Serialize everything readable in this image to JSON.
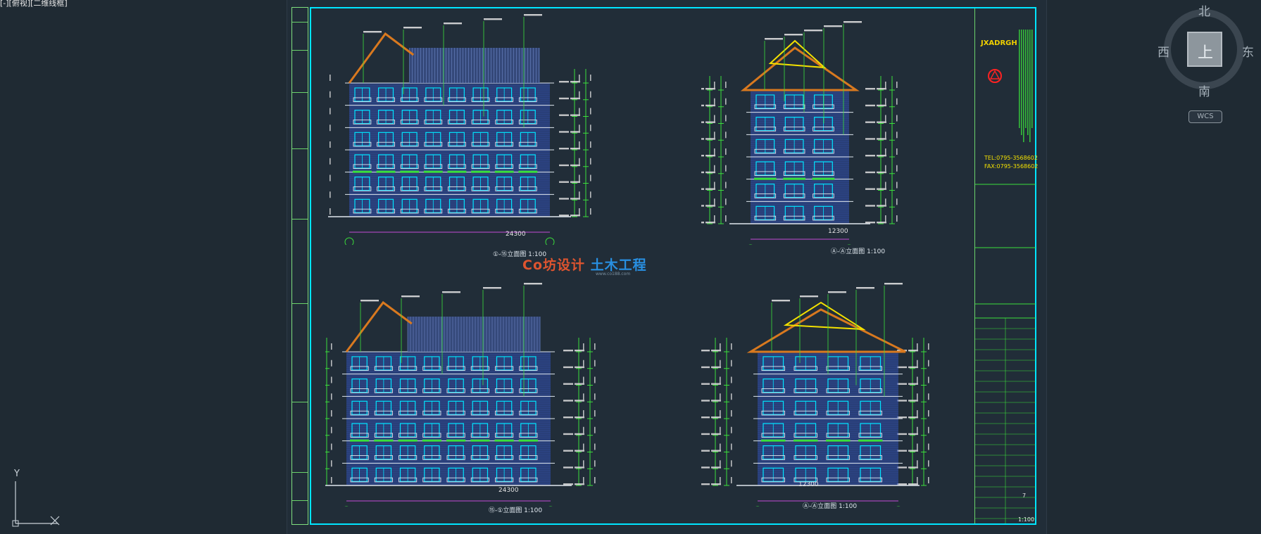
{
  "view": {
    "label": "[-][俯视][二维线框]"
  },
  "watermark": {
    "label": "Co 坊设计 土木工程",
    "main": "Co坊设计",
    "accent": "土木工程",
    "sub": "www.co188.com"
  },
  "compass": {
    "north": "北",
    "south": "南",
    "west": "西",
    "east": "东",
    "center": "上",
    "wcs": "WCS"
  },
  "ucs": {
    "y": "Y"
  },
  "title_block": {
    "brand": "JXADRGH",
    "tel": "TEL:0795-3568602",
    "fax": "FAX:0795-3568602",
    "scale": "1:100",
    "sheet": "7"
  },
  "drawings": [
    {
      "id": "front",
      "title": "①-⑮立面图 1:100",
      "width_dim": "24300"
    },
    {
      "id": "side-right",
      "title": "Ⓐ-Ⓐ立面图 1:100",
      "width_dim": "12300"
    },
    {
      "id": "back",
      "title": "⑮-①立面图 1:100",
      "width_dim": "24300"
    },
    {
      "id": "side-left",
      "title": "Ⓐ-Ⓐ立面图 1:100",
      "width_dim": "12300"
    }
  ],
  "colors": {
    "frame": "#00e5ff",
    "green": "#3be03b",
    "blue": "#2f4aa6",
    "orange": "#d9791f",
    "yellow": "#f3e000"
  }
}
